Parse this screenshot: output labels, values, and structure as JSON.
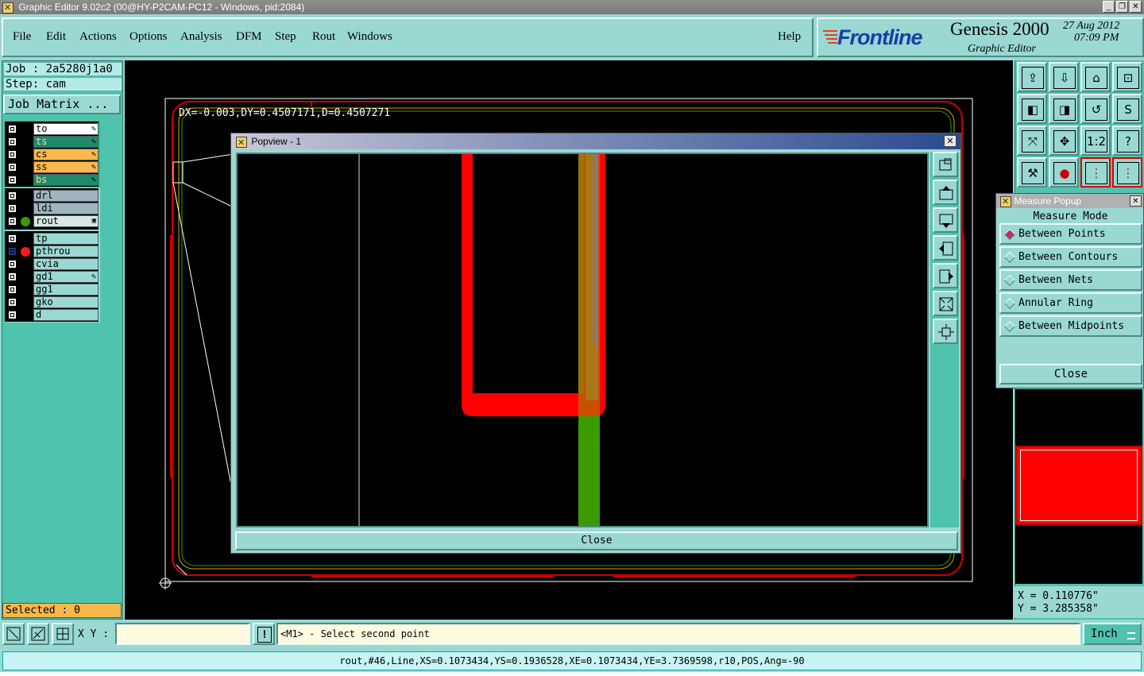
{
  "window": {
    "title": "Graphic Editor 9.02c2 (00@HY-P2CAM-PC12 - Windows, pid:2084)"
  },
  "menu": [
    "File",
    "Edit",
    "Actions",
    "Options",
    "Analysis",
    "DFM",
    "Step",
    "Rout",
    "Windows"
  ],
  "help": "Help",
  "brand": {
    "logo": "Frontline",
    "product": "Genesis 2000",
    "subtitle": "Graphic Editor",
    "date": "27 Aug 2012",
    "time": "07:09 PM"
  },
  "job": {
    "job_label": "Job : 2a5280j1a0",
    "step_label": "Step: cam",
    "matrix_button": "Job Matrix ..."
  },
  "layers": {
    "group1": [
      {
        "name": "to",
        "color": "#ffffff"
      },
      {
        "name": "ts",
        "color": "#1e8a6a"
      },
      {
        "name": "cs",
        "color": "#ffb84d"
      },
      {
        "name": "ss",
        "color": "#ffb84d"
      },
      {
        "name": "bs",
        "color": "#1e8a6a"
      }
    ],
    "group2": [
      {
        "name": "drl",
        "color": "#9fb4c0"
      },
      {
        "name": "ldi",
        "color": "#9fb4c0"
      },
      {
        "name": "rout",
        "color": "#d8e6e6"
      }
    ],
    "group3": [
      {
        "name": "tp",
        "color": "#9ad8d2"
      },
      {
        "name": "pthrou",
        "color": "#9ad8d2"
      },
      {
        "name": "cvia",
        "color": "#9ad8d2"
      },
      {
        "name": "gd1",
        "color": "#9ad8d2"
      },
      {
        "name": "gg1",
        "color": "#9ad8d2"
      },
      {
        "name": "gko",
        "color": "#9ad8d2"
      },
      {
        "name": "d",
        "color": "#9ad8d2"
      }
    ]
  },
  "selected": "Selected : 0",
  "measure_readout": "DX=-0.003,DY=0.4507171,D=0.4507271",
  "popview": {
    "title": "Popview - 1",
    "close": "Close"
  },
  "measure_popup": {
    "title": "Measure Popup",
    "header": "Measure Mode",
    "options": [
      "Between Points",
      "Between Contours",
      "Between Nets",
      "Annular Ring",
      "Between Midpoints"
    ],
    "selected_option": "Between Points",
    "close": "Close"
  },
  "coords": {
    "x": "X = 0.110776\"",
    "y": "Y = 3.285358\""
  },
  "bottom": {
    "xy_label": "X Y :",
    "xy_value": "",
    "prompt": "<M1> - Select second point",
    "units": "Inch"
  },
  "status_line": "rout,#46,Line,XS=0.1073434,YS=0.1936528,XE=0.1073434,YE=3.7369598,r10,POS,Ang=-90",
  "colors": {
    "panel": "#9ad8d2",
    "highlight_red": "#ff0000",
    "feature_green": "#3a9a00",
    "board_outline": "#cc0000"
  }
}
